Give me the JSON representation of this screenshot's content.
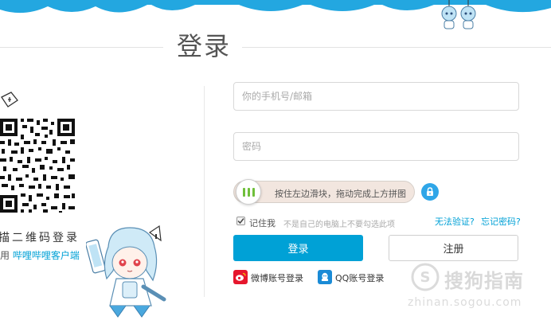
{
  "header": {
    "title": "登录"
  },
  "qr_panel": {
    "title": "扫描二维码登录",
    "title_visible": "描二维码登录",
    "subtitle_prefix": "请使用",
    "subtitle_prefix_visible": "用",
    "subtitle_link": "哔哩哔哩客户端"
  },
  "form": {
    "phone_placeholder": "你的手机号/邮箱",
    "password_placeholder": "密码",
    "slider_text": "按住左边滑块，拖动完成上方拼图",
    "remember_label": "记住我",
    "remember_checked": true,
    "remember_hint": "不是自己的电脑上不要勾选此项",
    "cannot_verify_link": "无法验证?",
    "forgot_password_link": "忘记密码?",
    "login_button": "登录",
    "register_button": "注册"
  },
  "third_party": {
    "weibo_label": "微博账号登录",
    "qq_label": "QQ账号登录"
  },
  "watermark": {
    "text": "搜狗指南",
    "url": "zhinan.sogou.com"
  },
  "colors": {
    "brand_blue": "#00a1d6",
    "cloud_blue": "#23a7e0",
    "slider_green": "#6fbf3a",
    "weibo_red": "#e6162d",
    "qq_blue": "#1a8bd6"
  },
  "icons": [
    "cloud-header",
    "qr-code",
    "refresh-icon",
    "slider-handle-icon",
    "lock-icon",
    "check-icon",
    "weibo-icon",
    "qq-icon",
    "sogou-logo"
  ]
}
